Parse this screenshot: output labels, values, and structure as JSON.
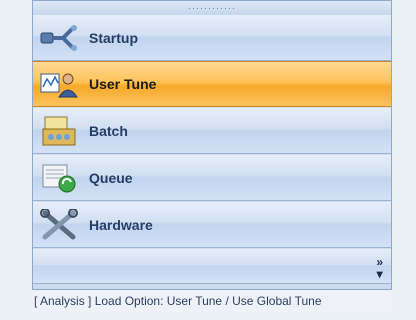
{
  "nav": {
    "items": [
      {
        "label": "Startup",
        "icon": "startup-connector-icon"
      },
      {
        "label": "User Tune",
        "icon": "user-tune-icon",
        "active": true
      },
      {
        "label": "Batch",
        "icon": "batch-icon"
      },
      {
        "label": "Queue",
        "icon": "queue-icon"
      },
      {
        "label": "Hardware",
        "icon": "hardware-tools-icon"
      }
    ],
    "overflow_icon": "chevron-double-down-icon"
  },
  "status": {
    "text": "[ Analysis ] Load Option: User Tune / Use Global Tune"
  },
  "colors": {
    "active_bg": "#ffc35a",
    "nav_bg": "#d3e0f2",
    "label_color": "#243e66"
  }
}
